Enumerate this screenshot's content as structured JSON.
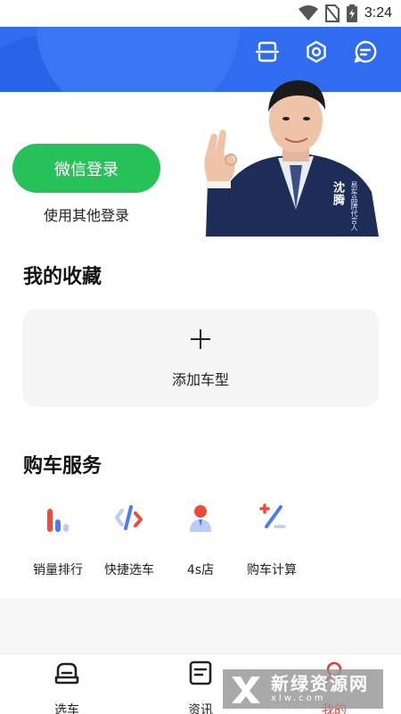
{
  "status_bar": {
    "time": "3:24",
    "icons": [
      "wifi-icon",
      "no-sim-icon",
      "battery-charging-icon"
    ]
  },
  "header": {
    "buttons": [
      "scan-icon",
      "settings-icon",
      "message-icon"
    ],
    "color": "#2f6cf0"
  },
  "login": {
    "wechat_label": "微信登录",
    "other_label": "使用其他登录",
    "wechat_color": "#27c15a"
  },
  "banner": {
    "name": "沈腾",
    "subtitle": "易车品牌代言人"
  },
  "favorites": {
    "title": "我的收藏",
    "add_label": "添加车型"
  },
  "services": {
    "title": "购车服务",
    "items": [
      {
        "label": "销量排行",
        "icon": "sales-ranking-icon"
      },
      {
        "label": "快捷选车",
        "icon": "quick-select-icon"
      },
      {
        "label": "4s店",
        "icon": "dealer-icon"
      },
      {
        "label": "购车计算",
        "icon": "calculator-icon"
      }
    ]
  },
  "bottom_nav": {
    "items": [
      {
        "label": "选车",
        "icon": "car-icon",
        "active": false
      },
      {
        "label": "资讯",
        "icon": "news-icon",
        "active": false
      },
      {
        "label": "我的",
        "icon": "profile-icon",
        "active": true
      }
    ],
    "active_color": "#e53935"
  },
  "watermark": {
    "title": "新绿资源网",
    "url": "xlw.com"
  }
}
